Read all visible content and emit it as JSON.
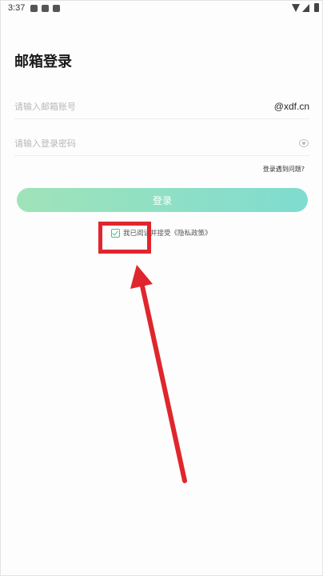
{
  "status_bar": {
    "time": "3:37"
  },
  "page": {
    "title": "邮箱登录"
  },
  "email_field": {
    "placeholder": "请输入邮箱账号",
    "value": "",
    "suffix": "@xdf.cn"
  },
  "password_field": {
    "placeholder": "请输入登录密码",
    "value": ""
  },
  "help": {
    "label": "登录遇到问题?"
  },
  "login_button": {
    "label": "登录"
  },
  "agreement": {
    "text": "我已阅读并接受",
    "link_label": "《隐私政策》",
    "checked": true
  },
  "colors": {
    "button_gradient_start": "#9fe3b9",
    "button_gradient_end": "#7fdcd0",
    "checkbox_accent": "#4bbf8a",
    "annotation": "#e0262d"
  },
  "icons": {
    "password_visibility": "eye-icon",
    "checkbox": "check-icon"
  }
}
